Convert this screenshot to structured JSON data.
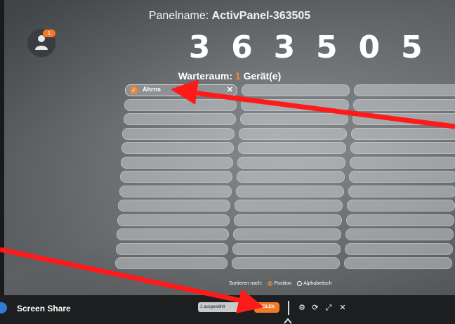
{
  "panel": {
    "name_label": "Panelname: ",
    "name_value": "ActivPanel-363505",
    "pin_digits": [
      "3",
      "6",
      "3",
      "5",
      "0",
      "5"
    ]
  },
  "user": {
    "badge_count": "1",
    "avatar_icon": "users-icon"
  },
  "waiting_room": {
    "label": "Warteraum: ",
    "count": "1",
    "unit": " Gerät(e)"
  },
  "devices": [
    {
      "name": "Ahrns",
      "selected": true
    }
  ],
  "sort": {
    "label": "Sortieren nach:",
    "options": [
      {
        "label": "Position",
        "selected": true
      },
      {
        "label": "Alphabetisch",
        "selected": false
      }
    ]
  },
  "bottombar": {
    "title": "Screen Share",
    "selection_value": "1 ausgewählt",
    "share_label": "TEILEN",
    "icons": [
      "settings-icon",
      "refresh-icon",
      "expand-icon",
      "close-icon"
    ]
  },
  "colors": {
    "accent": "#f07a2a",
    "annotation_arrow": "#ff1a1a",
    "bar_bg": "#1d1e20"
  }
}
